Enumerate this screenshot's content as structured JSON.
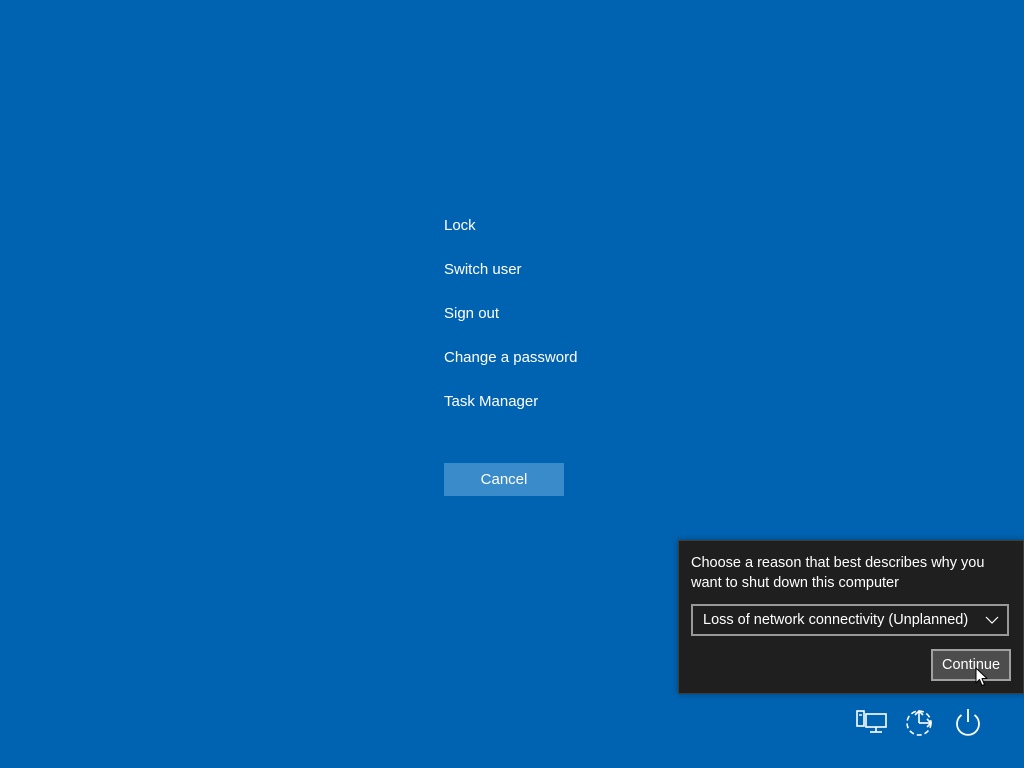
{
  "menu": {
    "items": [
      {
        "label": "Lock"
      },
      {
        "label": "Switch user"
      },
      {
        "label": "Sign out"
      },
      {
        "label": "Change a password"
      },
      {
        "label": "Task Manager"
      }
    ]
  },
  "cancel_label": "Cancel",
  "shutdown_reason": {
    "prompt": "Choose a reason that best describes why you want to shut down this computer",
    "selected_reason": "Loss of network connectivity (Unplanned)",
    "continue_label": "Continue"
  },
  "tray": {
    "icons": [
      "network-icon",
      "ease-of-access-icon",
      "power-icon"
    ]
  },
  "colors": {
    "background": "#0063b1",
    "cancel_button": "#3a8bc9",
    "flyout_background": "#1f1f1f",
    "text": "#ffffff"
  }
}
